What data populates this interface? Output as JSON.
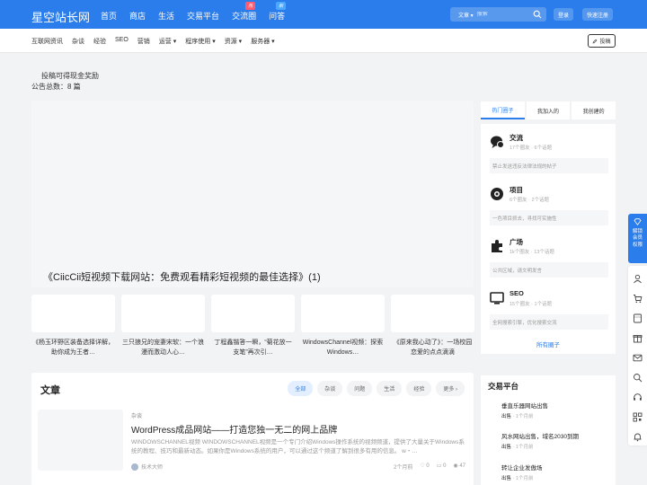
{
  "header": {
    "logo": "星空站长网",
    "nav": [
      {
        "label": "首页"
      },
      {
        "label": "商店"
      },
      {
        "label": "生活"
      },
      {
        "label": "交易平台"
      },
      {
        "label": "交流圈",
        "badge": "热"
      },
      {
        "label": "问答",
        "badge": "新"
      }
    ],
    "search": {
      "select": "文章 ▾",
      "placeholder": "搜索"
    },
    "login": "登录",
    "register": "快速注册"
  },
  "subnav": {
    "items": [
      "互联网资讯",
      "杂谈",
      "经验",
      "SEO",
      "营销",
      "运营 ▾",
      "程序使用 ▾",
      "资源 ▾",
      "服务器 ▾"
    ],
    "post_button": "投稿"
  },
  "notice": {
    "text": "投稿可得现金奖励",
    "count": "公告总数：8 篇"
  },
  "banner": {
    "title": "《CiicCii短视频下载网站：免费观看精彩短视频的最佳选择》(1)"
  },
  "thumbs": [
    "《杨玉环野区装备选择详解，助你成为王者…",
    "三只狼兄的宠妻宋软：一个浪漫而激动人心…",
    "丁程鑫锴答一瞬，“菊花放一支笔”再次引…",
    "WindowsChannel视频：探索Windows…",
    "《原来我心动了》：一场校园恋爱的点点滴滴"
  ],
  "articles": {
    "title": "文章",
    "tabs": [
      "全部",
      "杂谈",
      "问题",
      "生活",
      "经验",
      "更多 ›"
    ],
    "post": {
      "category": "杂谈",
      "title": "WordPress成品网站——打造您独一无二的网上品牌",
      "desc": "WINDOWSCHANNEL视频 WINDOWSCHANNEL视频是一个专门介绍Windows操作系统的视频频道，提供了大量关于Windows系统的教程、技巧和最新动态。如果你是Windows系统的用户，可以通过这个频道了解到很多有用的信息。 w・…",
      "author": "技术大师",
      "time": "2个月前",
      "likes": "0",
      "comments": "0",
      "views": "47"
    }
  },
  "circles": {
    "tabs": [
      "热门圈子",
      "我加入的",
      "我创建的"
    ],
    "items": [
      {
        "name": "交流",
        "meta": "17个圈友 · 6个话题",
        "desc": "禁止发送违反法律法规的帖子",
        "icon": "chat-bubble-icon"
      },
      {
        "name": "项目",
        "meta": "6个圈友 · 2个话题",
        "desc": "一色项目抓去，寻找可实施性",
        "icon": "target-icon"
      },
      {
        "name": "广场",
        "meta": "1k个圈友 · 13个话题",
        "desc": "公共区域，请文明发言",
        "icon": "puzzle-icon"
      },
      {
        "name": "SEO",
        "meta": "15个圈友 · 1个话题",
        "desc": "全网搜索引擎，优化搜索交流",
        "icon": "monitor-icon"
      }
    ],
    "all": "所有圈子"
  },
  "trade": {
    "title": "交易平台",
    "items": [
      {
        "title": "垂直乐器网站出售",
        "status": "出售",
        "time": "1个月前"
      },
      {
        "title": "风水网站出售，域名2030到期",
        "status": "出售",
        "time": "1个月前"
      },
      {
        "title": "转让企业发傲场",
        "status": "出售",
        "time": "1个月前"
      }
    ]
  },
  "float": {
    "promo": "解锁\n会员\n权限"
  }
}
